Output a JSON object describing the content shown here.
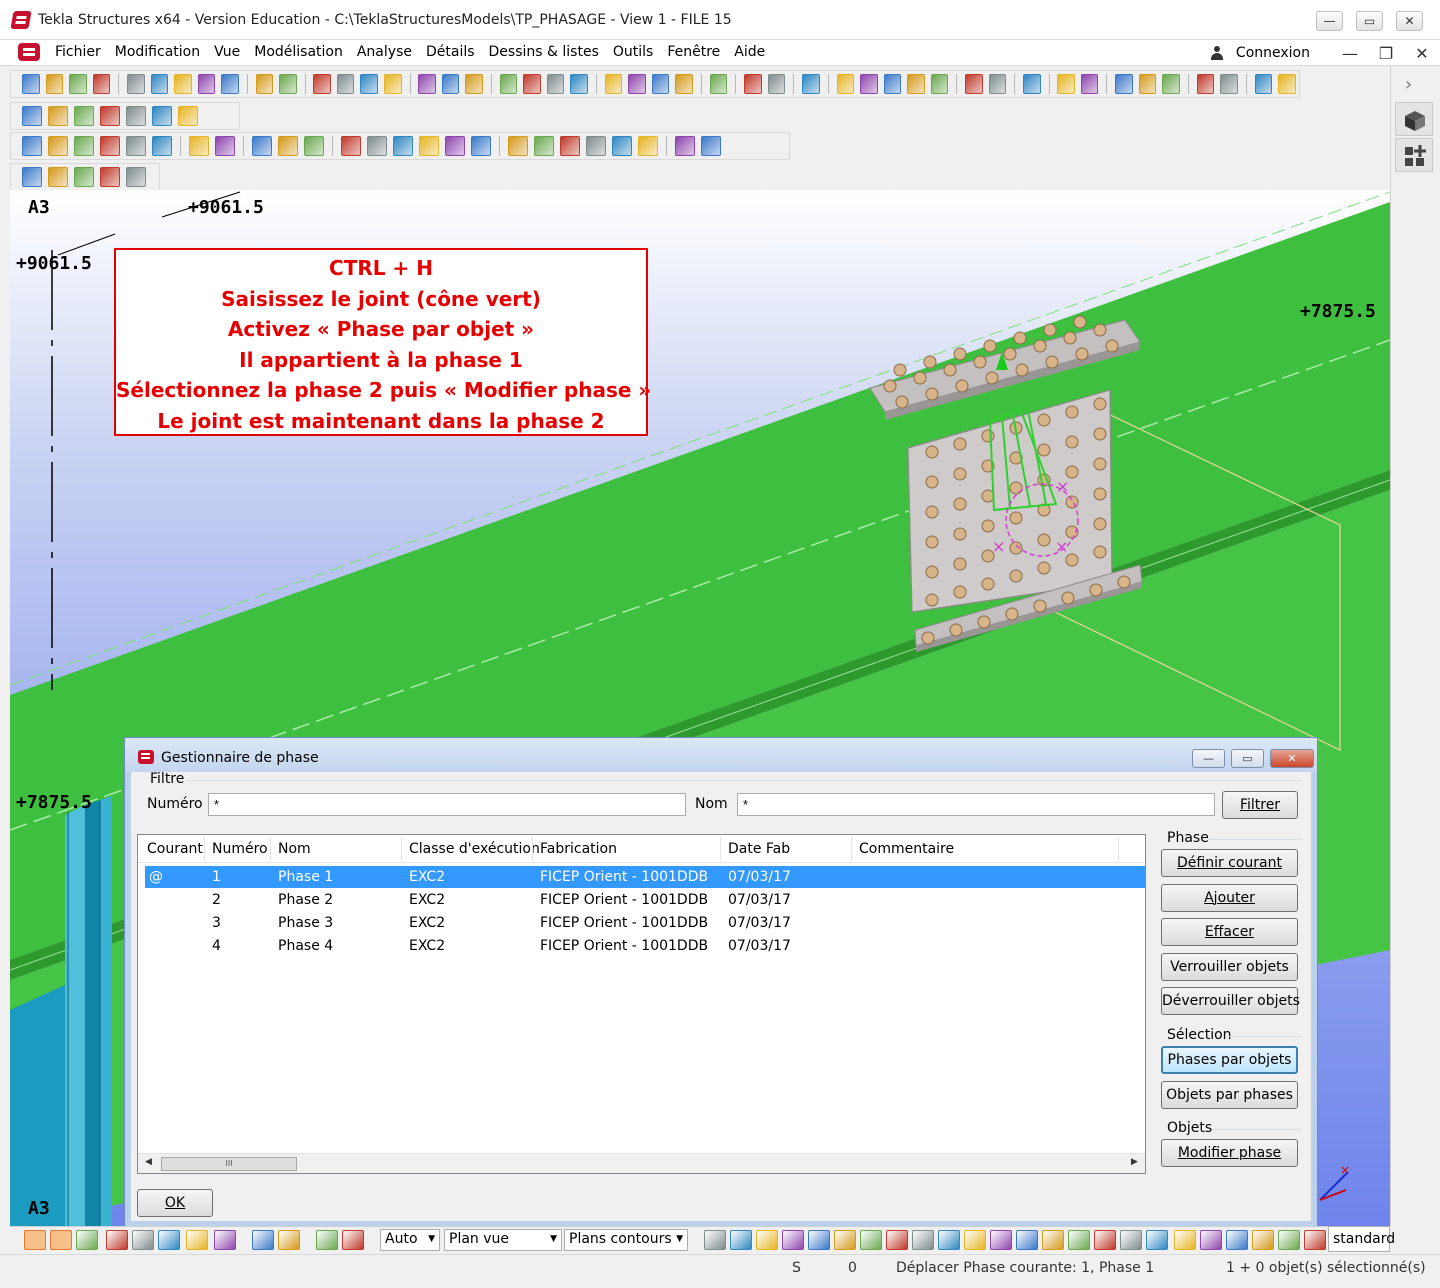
{
  "window": {
    "title": "Tekla Structures x64 - Version Education - C:\\TeklaStructuresModels\\TP_PHASAGE  - View 1 - FILE 15",
    "minimize": "—",
    "maximize": "▭",
    "close": "✕"
  },
  "menu": {
    "items": [
      "Fichier",
      "Modification",
      "Vue",
      "Modélisation",
      "Analyse",
      "Détails",
      "Dessins & listes",
      "Outils",
      "Fenêtre",
      "Aide"
    ],
    "login": "Connexion",
    "mdi_min": "—",
    "mdi_restore": "❐",
    "mdi_close": "✕"
  },
  "viewport": {
    "grid_label_top": "A3",
    "grid_label_bottom": "A3",
    "dim_top_right": "+9061.5",
    "dim_top_left": "+9061.5",
    "dim_right": "+7875.5",
    "dim_left": "+7875.5"
  },
  "annotation": {
    "lines": [
      "CTRL + H",
      "Saisissez le joint (cône vert)",
      "Activez « Phase par objet »",
      "Il appartient à la phase 1",
      "Sélectionnez la phase 2 puis « Modifier phase »",
      "Le joint est maintenant  dans la phase  2"
    ],
    "color": "#e60000"
  },
  "dialog": {
    "title": "Gestionnaire de phase",
    "filter": {
      "group_label": "Filtre",
      "number_label": "Numéro",
      "number_value": "*",
      "name_label": "Nom",
      "name_value": "*",
      "filter_button": "Filtrer"
    },
    "table": {
      "columns": [
        "Courant",
        "Numéro",
        "Nom",
        "Classe d'exécution",
        "Fabrication",
        "Date Fab",
        "Commentaire"
      ],
      "rows": [
        {
          "current": "@",
          "number": "1",
          "name": "Phase 1",
          "class": "EXC2",
          "fabrication": "FICEP Orient - 1001DDB",
          "date": "07/03/17",
          "comment": "",
          "selected": true
        },
        {
          "current": "",
          "number": "2",
          "name": "Phase 2",
          "class": "EXC2",
          "fabrication": "FICEP Orient - 1001DDB",
          "date": "07/03/17",
          "comment": "",
          "selected": false
        },
        {
          "current": "",
          "number": "3",
          "name": "Phase 3",
          "class": "EXC2",
          "fabrication": "FICEP Orient - 1001DDB",
          "date": "07/03/17",
          "comment": "",
          "selected": false
        },
        {
          "current": "",
          "number": "4",
          "name": "Phase 4",
          "class": "EXC2",
          "fabrication": "FICEP Orient - 1001DDB",
          "date": "07/03/17",
          "comment": "",
          "selected": false
        }
      ],
      "scroll_thumb": "III",
      "scroll_left": "◀",
      "scroll_right": "▶"
    },
    "phase_group": {
      "label": "Phase",
      "set_current": "Définir courant",
      "add": "Ajouter",
      "delete": "Effacer",
      "lock": "Verrouiller objets",
      "unlock": "Déverrouiller objets"
    },
    "selection_group": {
      "label": "Sélection",
      "phases_by_objects": "Phases par objets",
      "objects_by_phases": "Objets par phases"
    },
    "objects_group": {
      "label": "Objets",
      "modify_phase": "Modifier phase"
    },
    "ok": "OK"
  },
  "bottom_toolbar": {
    "combo_auto": "Auto",
    "combo_plan": "Plan vue",
    "combo_contours": "Plans contours",
    "standard": "standard"
  },
  "status": {
    "s": "S",
    "zero": "0",
    "message": "Déplacer Phase courante: 1, Phase 1",
    "selection": "1 + 0 objet(s) sélectionné(s)"
  },
  "colors": {
    "beam_green": "#3fbf3f",
    "column_teal": "#1a9bbf",
    "plate_grey": "#c4c0c0",
    "selection_blue": "#3399ff"
  }
}
